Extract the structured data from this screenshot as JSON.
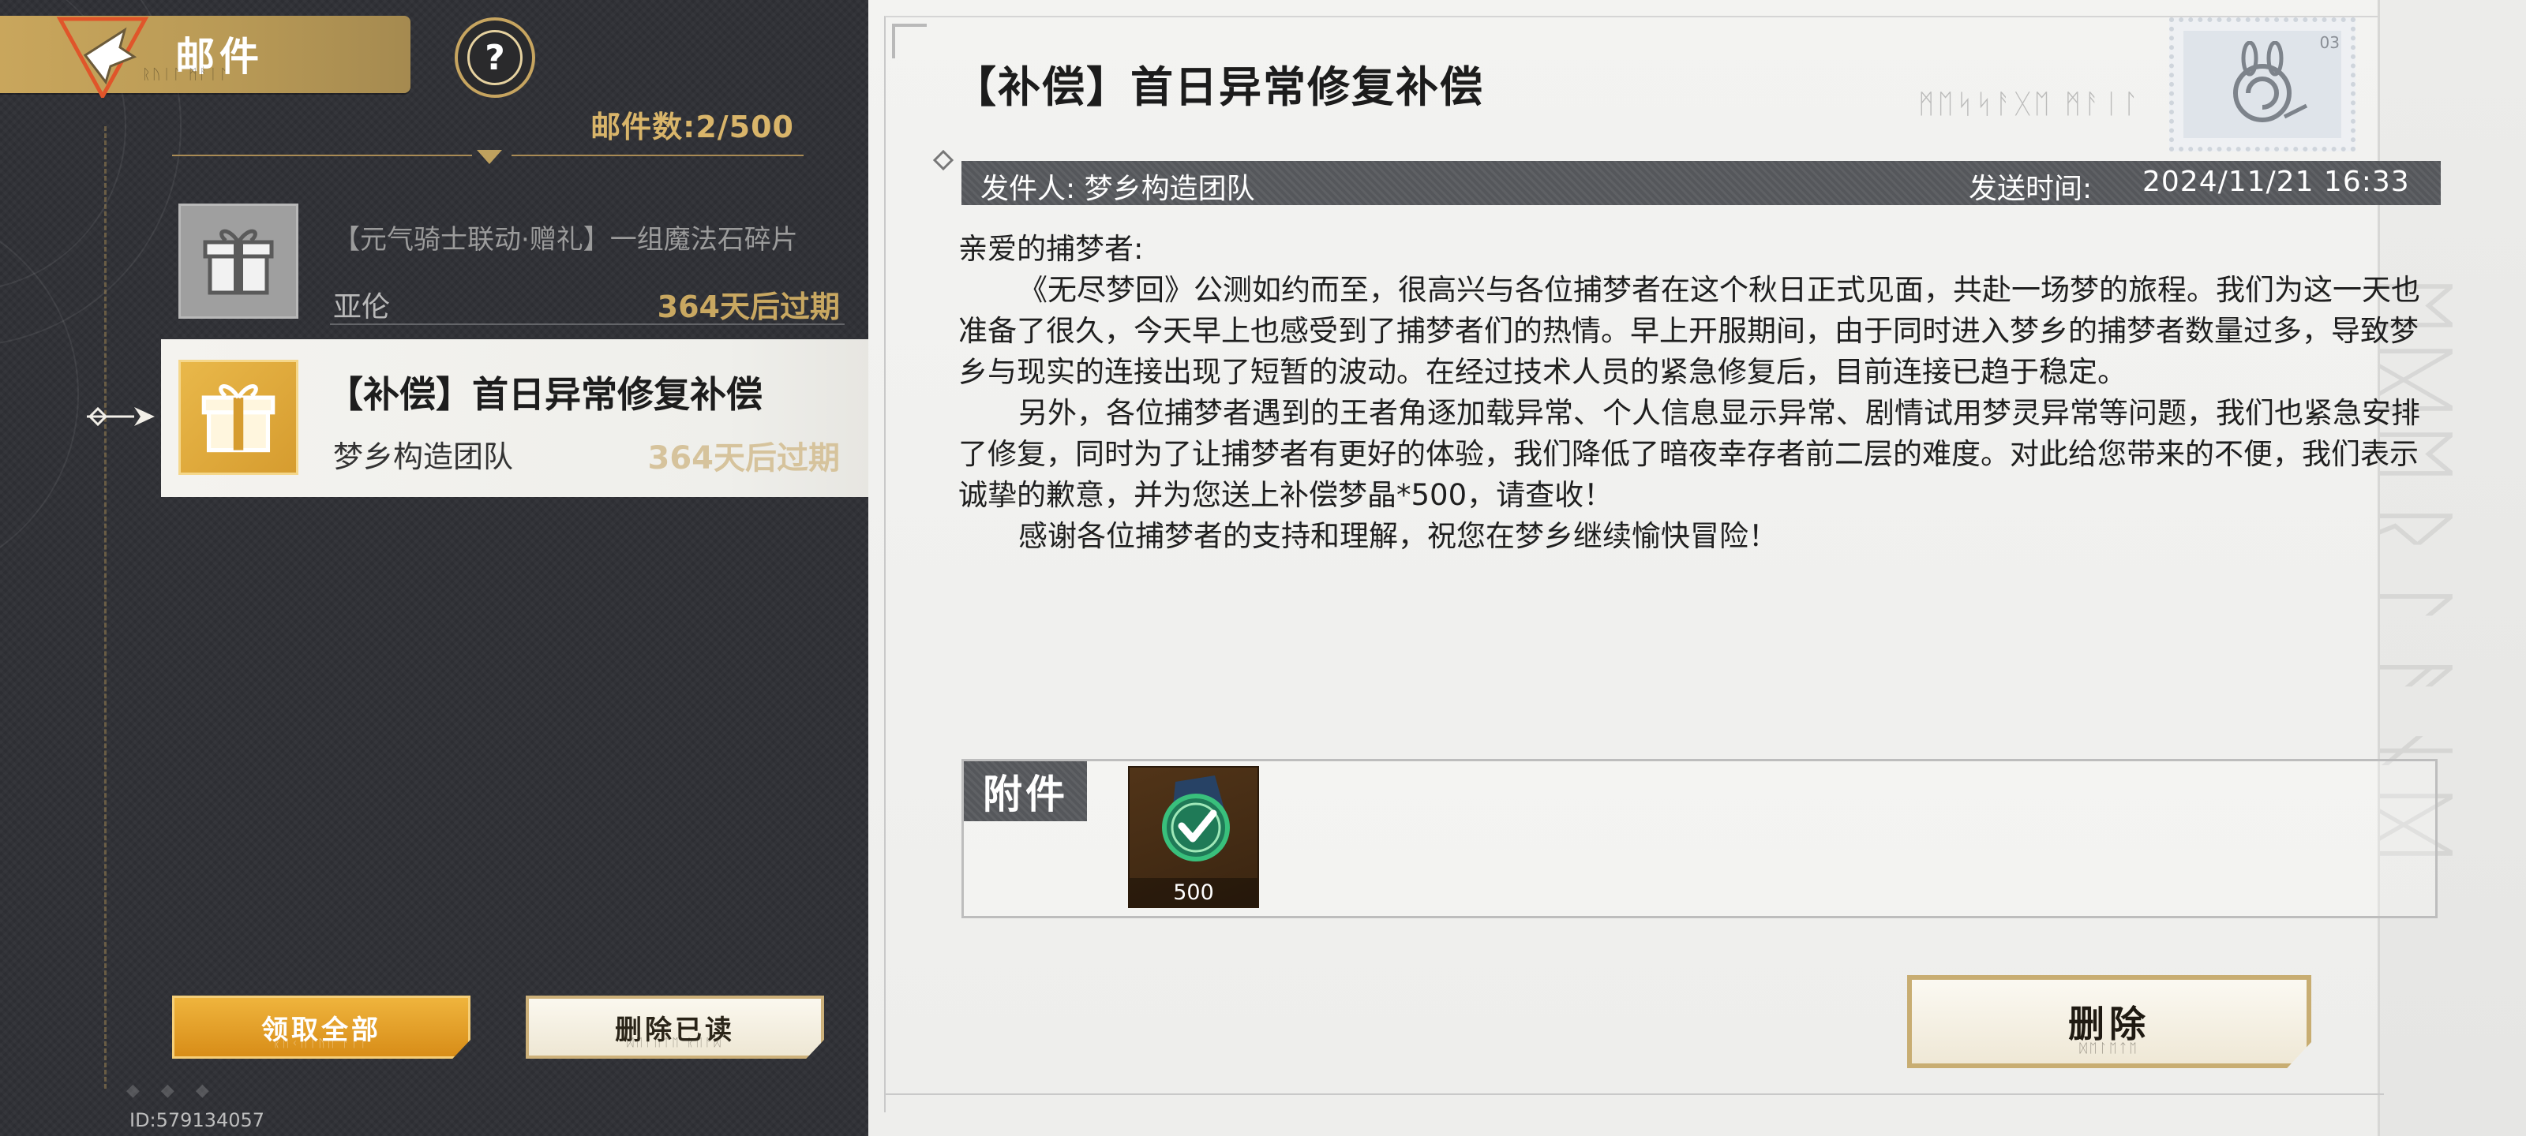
{
  "header": {
    "title": "邮件",
    "mail_count": "邮件数:2/500"
  },
  "mail_list": [
    {
      "title": "【元气骑士联动·赠礼】一组魔法石碎片",
      "sender": "亚伦",
      "expiry": "364天后过期",
      "selected": false
    },
    {
      "title": "【补偿】首日异常修复补偿",
      "sender": "梦乡构造团队",
      "expiry": "364天后过期",
      "selected": true
    }
  ],
  "actions": {
    "claim_all_label": "领取全部",
    "delete_read_label": "删除已读"
  },
  "user_id": "ID:579134057",
  "detail": {
    "subject": "【补偿】首日异常修复补偿",
    "stamp_number": "03",
    "sender_line": "发件人: 梦乡构造团队",
    "send_time_label": "发送时间:",
    "send_time_value": "2024/11/21 16:33",
    "body": [
      "亲爱的捕梦者:",
      "《无尽梦回》公测如约而至，很高兴与各位捕梦者在这个秋日正式见面，共赴一场梦的旅程。我们为这一天也准备了很久，今天早上也感受到了捕梦者们的热情。早上开服期间，由于同时进入梦乡的捕梦者数量过多，导致梦乡与现实的连接出现了短暂的波动。在经过技术人员的紧急修复后，目前连接已趋于稳定。",
      "另外，各位捕梦者遇到的王者角逐加载异常、个人信息显示异常、剧情试用梦灵异常等问题，我们也紧急安排了修复，同时为了让捕梦者有更好的体验，我们降低了暗夜幸存者前二层的难度。对此给您带来的不便，我们表示诚挚的歉意，并为您送上补偿梦晶*500，请查收！",
      "感谢各位捕梦者的支持和理解，祝您在梦乡继续愉快冒险！"
    ],
    "attachments_label": "附件",
    "attachments": [
      {
        "icon": "dream-crystal-icon",
        "quantity": "500"
      }
    ],
    "delete_label": "删除"
  },
  "colors": {
    "accent_gold": "#c9a65c",
    "claim_orange": "#e09a22",
    "info_bar": "#55575b",
    "expiry_gold": "#c9a861"
  }
}
